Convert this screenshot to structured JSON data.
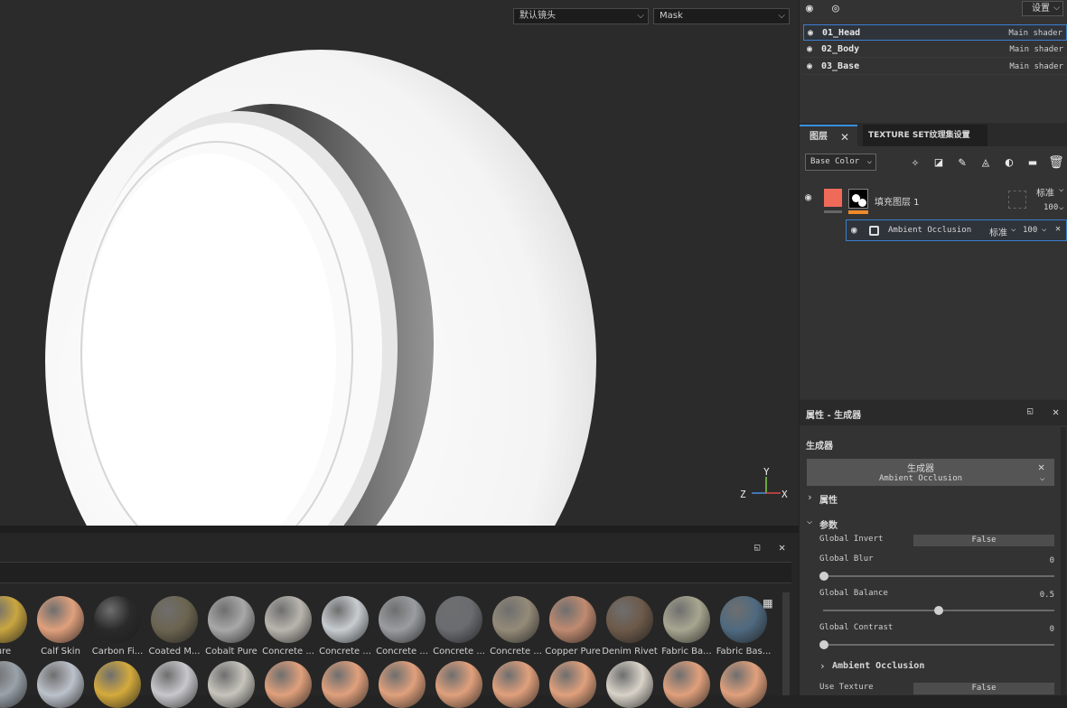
{
  "viewport": {
    "camera_select": "默认镜头",
    "channel_select": "Mask",
    "axes": {
      "x": "X",
      "y": "Y",
      "z": "Z"
    }
  },
  "texture_sets": {
    "settings_label": "设置",
    "items": [
      {
        "name": "01_Head",
        "shader": "Main shader"
      },
      {
        "name": "02_Body",
        "shader": "Main shader"
      },
      {
        "name": "03_Base",
        "shader": "Main shader"
      }
    ]
  },
  "layers_panel": {
    "tab_layers": "图层",
    "tab_texture_set": "TEXTURE SET纹理集设置",
    "channel_select": "Base Color",
    "fill_layer": {
      "name": "填充图层 1",
      "blend": "标准",
      "opacity": "100"
    },
    "ao_effect": {
      "name": "Ambient Occlusion",
      "blend": "标准",
      "opacity": "100"
    }
  },
  "properties": {
    "title": "属性 - 生成器",
    "section": "生成器",
    "generator_name": "生成器",
    "generator_type": "Ambient Occlusion",
    "group_props": "属性",
    "group_params": "参数",
    "params": {
      "global_invert_label": "Global Invert",
      "global_invert_value": "False",
      "global_blur_label": "Global Blur",
      "global_blur_value": "0",
      "global_balance_label": "Global Balance",
      "global_balance_value": "0.5",
      "global_contrast_label": "Global Contrast",
      "global_contrast_value": "0"
    },
    "group_ao": "Ambient Occlusion",
    "use_texture_label": "Use Texture",
    "use_texture_value": "False"
  },
  "shelf": {
    "row1": [
      "ure",
      "Calf Skin",
      "Carbon Fi...",
      "Coated M...",
      "Cobalt Pure",
      "Concrete ...",
      "Concrete ...",
      "Concrete ...",
      "Concrete ...",
      "Concrete ...",
      "Copper Pure",
      "Denim Rivet",
      "Fabric Ba...",
      "Fabric Bas..."
    ],
    "row1_colors": [
      "#c9a640",
      "#e0a07c",
      "#2a2a2a",
      "#6b6450",
      "#a8a8a8",
      "#b9b5ae",
      "#c7ccd0",
      "#9a9da0",
      "#6a6c70",
      "#948a78",
      "#c08a70",
      "#6d5a4a",
      "#a8a690",
      "#4f6a80"
    ],
    "row2_colors": [
      "#9aa2aa",
      "#bcc2ca",
      "#d4aa3c",
      "#c8c8cc",
      "#c6c4bc",
      "#e0a07c",
      "#e0a07c",
      "#e0a07c",
      "#e0a07c",
      "#e0a07c",
      "#e0a07c",
      "#d8d2c8",
      "#e0a07c",
      "#e0a07c"
    ]
  }
}
